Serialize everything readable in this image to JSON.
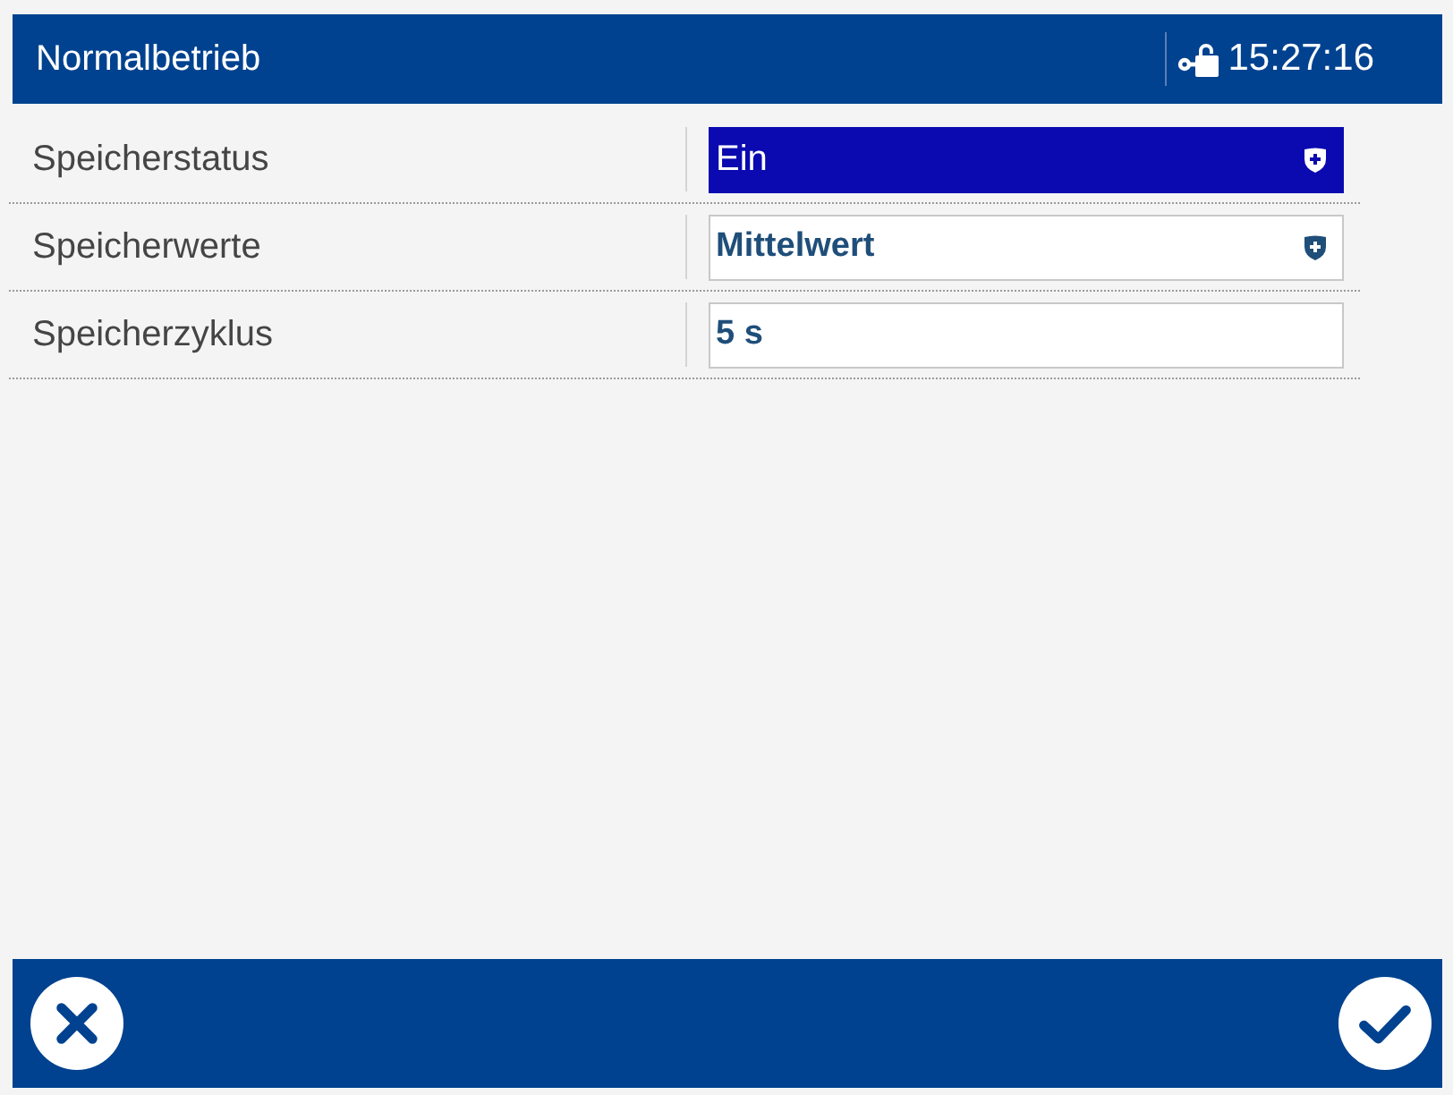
{
  "header": {
    "title": "Normalbetrieb",
    "time": "15:27:16"
  },
  "settings": [
    {
      "label": "Speicherstatus",
      "value": "Ein",
      "kind": "dropdown",
      "selected": true
    },
    {
      "label": "Speicherwerte",
      "value": "Mittelwert",
      "kind": "dropdown",
      "selected": false
    },
    {
      "label": "Speicherzyklus",
      "value": "5 s",
      "kind": "input",
      "selected": false
    }
  ]
}
